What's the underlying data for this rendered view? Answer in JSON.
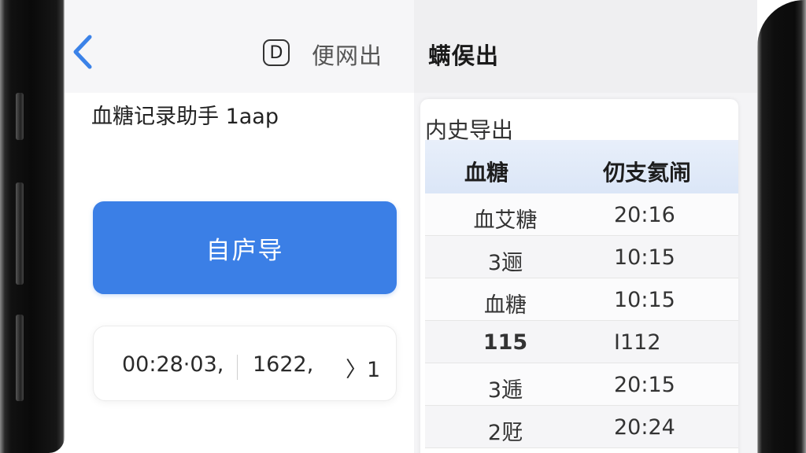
{
  "nav": {
    "back_icon": "chevron-left-icon",
    "d_icon_glyph": "D",
    "link_1": "便网出",
    "link_2": "螨㑨出"
  },
  "main": {
    "app_name": "血糖记录助手 1aap",
    "primary_button": "自庐导",
    "input": {
      "segment_1": "00:28·03,",
      "segment_2": "1622,",
      "segment_3": "〉1"
    }
  },
  "table": {
    "title": "内史导出",
    "columns": [
      "血糖",
      "仞支氦闹"
    ],
    "rows": [
      {
        "value": "血艾糖",
        "time": "20:16",
        "bold": false
      },
      {
        "value": "3逦",
        "time": "10:15",
        "bold": false
      },
      {
        "value": "血糖",
        "time": "10:15",
        "bold": false
      },
      {
        "value": "115",
        "time": "I112",
        "bold": true
      },
      {
        "value": "3逓",
        "time": "20:15",
        "bold": false
      },
      {
        "value": "2觃",
        "time": "20:24",
        "bold": false
      }
    ]
  },
  "colors": {
    "accent": "#3b7fe6",
    "header_bg": "#dbe6f7"
  }
}
